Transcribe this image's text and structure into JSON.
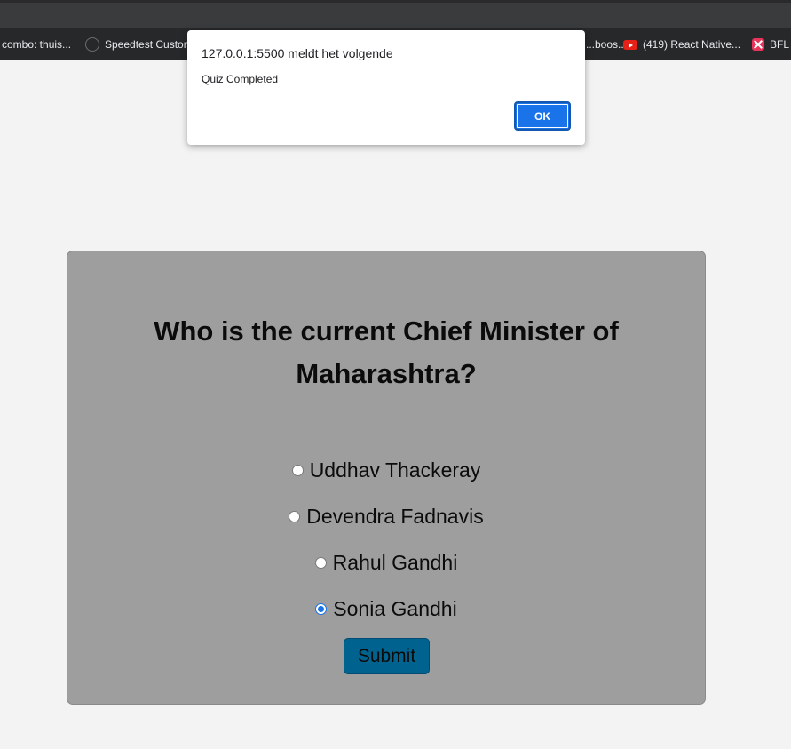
{
  "browser": {
    "bookmarks": [
      {
        "label": "combo: thuis...",
        "icon": "none"
      },
      {
        "label": "Speedtest Custom...",
        "icon": "speedtest-icon"
      },
      {
        "label": "...boos...",
        "icon": "none"
      },
      {
        "label": "(419) React Native...",
        "icon": "youtube-icon"
      },
      {
        "label": "BFL",
        "icon": "bfl-icon"
      }
    ]
  },
  "dialog": {
    "title": "127.0.0.1:5500 meldt het volgende",
    "message": "Quiz Completed",
    "ok_label": "OK"
  },
  "quiz": {
    "question": "Who is the current Chief Minister of Maharashtra?",
    "options": [
      {
        "label": "Uddhav Thackeray",
        "checked": false
      },
      {
        "label": "Devendra Fadnavis",
        "checked": false
      },
      {
        "label": "Rahul Gandhi",
        "checked": false
      },
      {
        "label": "Sonia Gandhi",
        "checked": true
      }
    ],
    "submit_label": "Submit"
  },
  "colors": {
    "page_bg": "#f3f3f3",
    "card_bg": "#9e9e9e",
    "submit_bg": "#00638f",
    "accent": "#1a73e8"
  }
}
